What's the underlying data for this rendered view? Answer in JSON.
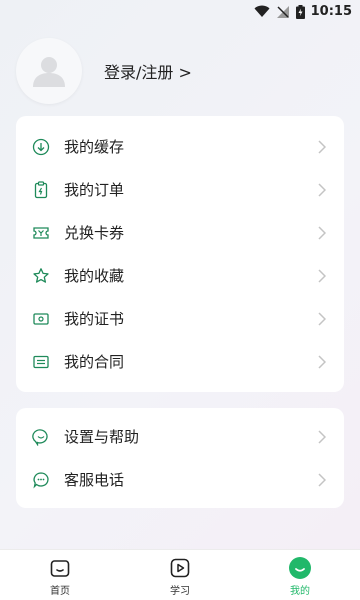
{
  "status_bar": {
    "time": "10:15"
  },
  "profile": {
    "login_label": "登录/注册 >"
  },
  "menu_group_1": [
    {
      "label": "我的缓存",
      "icon": "download-icon"
    },
    {
      "label": "我的订单",
      "icon": "order-icon"
    },
    {
      "label": "兑换卡券",
      "icon": "coupon-icon"
    },
    {
      "label": "我的收藏",
      "icon": "star-icon"
    },
    {
      "label": "我的证书",
      "icon": "certificate-icon"
    },
    {
      "label": "我的合同",
      "icon": "contract-icon"
    }
  ],
  "menu_group_2": [
    {
      "label": "设置与帮助",
      "icon": "settings-help-icon"
    },
    {
      "label": "客服电话",
      "icon": "service-chat-icon"
    }
  ],
  "tabs": [
    {
      "label": "首页",
      "icon": "home-icon",
      "active": false
    },
    {
      "label": "学习",
      "icon": "play-icon",
      "active": false
    },
    {
      "label": "我的",
      "icon": "profile-icon",
      "active": true
    }
  ],
  "colors": {
    "accent": "#21b86a",
    "icon_green": "#1f8a5a",
    "text": "#222222",
    "chevron": "#c4c4c4"
  }
}
